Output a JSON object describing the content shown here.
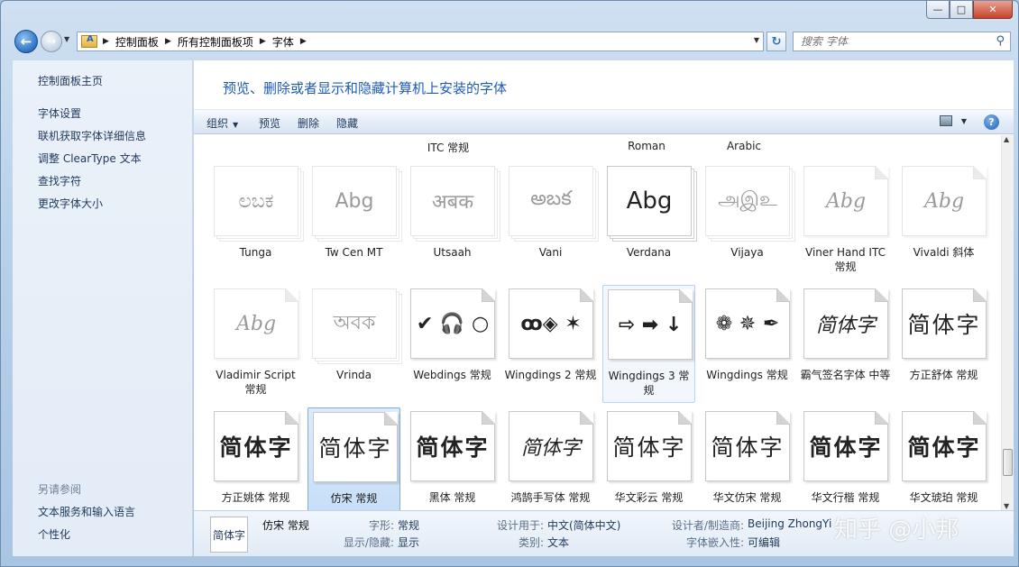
{
  "window": {
    "caption_buttons": [
      "—",
      "□",
      "✕"
    ]
  },
  "address_bar": {
    "crumbs": [
      "控制面板",
      "所有控制面板项",
      "字体"
    ],
    "search_placeholder": "搜索 字体"
  },
  "left_pane": {
    "home": "控制面板主页",
    "links": [
      "字体设置",
      "联机获取字体详细信息",
      "调整 ClearType 文本",
      "查找字符",
      "更改字体大小"
    ],
    "see_also_title": "另请参阅",
    "see_also": [
      "文本服务和输入语言",
      "个性化"
    ]
  },
  "main": {
    "title": "预览、删除或者显示和隐藏计算机上安装的字体"
  },
  "toolbar": {
    "organize": "组织",
    "preview": "预览",
    "delete": "删除",
    "hide": "隐藏"
  },
  "partial_row": [
    "ITC 常规",
    "Roman",
    "Arabic"
  ],
  "fonts": [
    {
      "name": "Tunga",
      "sample": "ಲಬಕ",
      "stack": true,
      "faded": true
    },
    {
      "name": "Tw Cen MT",
      "sample": "Abg",
      "stack": true,
      "faded": true
    },
    {
      "name": "Utsaah",
      "sample": "अबक",
      "stack": true,
      "faded": true
    },
    {
      "name": "Vani",
      "sample": "అబక",
      "stack": true,
      "faded": true
    },
    {
      "name": "Verdana",
      "sample": "Abg",
      "stack": true,
      "faded": false
    },
    {
      "name": "Vijaya",
      "sample": "அஇஉ",
      "stack": true,
      "faded": true
    },
    {
      "name": "Viner Hand ITC 常规",
      "sample": "Abg",
      "stack": false,
      "faded": true
    },
    {
      "name": "Vivaldi 斜体",
      "sample": "Abg",
      "stack": false,
      "faded": true
    },
    {
      "name": "Vladimir Script 常规",
      "sample": "Abg",
      "stack": false,
      "faded": true
    },
    {
      "name": "Vrinda",
      "sample": "অবক",
      "stack": true,
      "faded": true
    },
    {
      "name": "Webdings 常规",
      "sample": "✔ 🎧 ○",
      "stack": false,
      "faded": false
    },
    {
      "name": "Wingdings 2 常规",
      "sample": "ꝏ◈ ✶",
      "stack": false,
      "faded": false
    },
    {
      "name": "Wingdings 3 常规",
      "sample": "⇨ ➡ ↓",
      "stack": false,
      "faded": false
    },
    {
      "name": "Wingdings 常规",
      "sample": "❁ ✵ ✒",
      "stack": false,
      "faded": false
    },
    {
      "name": "霸气签名字体 中等",
      "sample": "简体字",
      "stack": false,
      "faded": false
    },
    {
      "name": "方正舒体 常规",
      "sample": "简体字",
      "stack": false,
      "faded": false
    },
    {
      "name": "方正姚体 常规",
      "sample": "简体字",
      "stack": false,
      "faded": false
    },
    {
      "name": "仿宋 常规",
      "sample": "简体字",
      "stack": false,
      "faded": false
    },
    {
      "name": "黑体 常规",
      "sample": "简体字",
      "stack": false,
      "faded": false
    },
    {
      "name": "鸿鹄手写体 常规",
      "sample": "简体字",
      "stack": false,
      "faded": false
    },
    {
      "name": "华文彩云 常规",
      "sample": "简体字",
      "stack": false,
      "faded": false
    },
    {
      "name": "华文仿宋 常规",
      "sample": "简体字",
      "stack": false,
      "faded": false
    },
    {
      "name": "华文行楷 常规",
      "sample": "简体字",
      "stack": false,
      "faded": false
    },
    {
      "name": "华文琥珀 常规",
      "sample": "简体字",
      "stack": false,
      "faded": false
    }
  ],
  "details": {
    "thumb": "简体字",
    "name": "仿宋 常规",
    "style_label": "字形:",
    "style_value": "常规",
    "show_label": "显示/隐藏:",
    "show_value": "显示",
    "designed_label": "设计用于:",
    "designed_value": "中文(简体中文)",
    "category_label": "类别:",
    "category_value": "文本",
    "designer_label": "设计者/制造商:",
    "designer_value": "Beijing ZhongYi",
    "embed_label": "字体嵌入性:",
    "embed_value": "可编辑",
    "watermark": "知乎 @小邦"
  }
}
